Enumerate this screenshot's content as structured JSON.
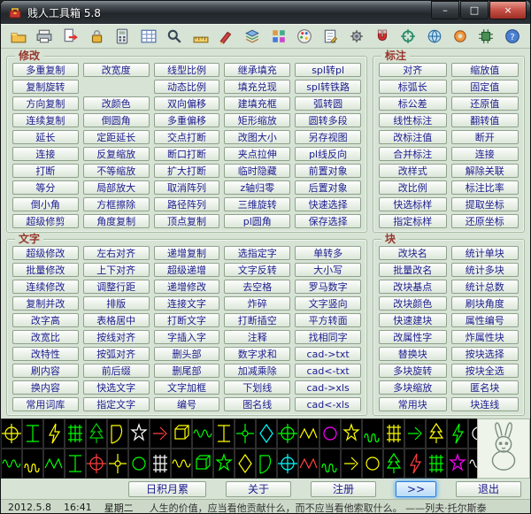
{
  "window": {
    "title": "贱人工具箱 5.8"
  },
  "titlebar_controls": {
    "minimize": "–",
    "maximize": "□",
    "close": "×"
  },
  "colors": {
    "dialog_bg": "#d6e3d5",
    "button_text": "#1b1b8e",
    "group_title": "#97372c",
    "focus_highlight": "#5fb2f5",
    "palette_bg": "#000000"
  },
  "toolbar": {
    "icons": [
      {
        "name": "open-folder-icon",
        "type": "folder"
      },
      {
        "name": "print-icon",
        "type": "print"
      },
      {
        "name": "export-icon",
        "type": "export"
      },
      {
        "name": "lock-icon",
        "type": "lock"
      },
      {
        "name": "calculator-icon",
        "type": "calculator"
      },
      {
        "name": "table-icon",
        "type": "table"
      },
      {
        "name": "search-icon",
        "type": "search"
      },
      {
        "name": "ruler-icon",
        "type": "ruler"
      },
      {
        "name": "brush-icon",
        "type": "brush"
      },
      {
        "name": "layers-icon",
        "type": "layers"
      },
      {
        "name": "blocks-icon",
        "type": "blocks"
      },
      {
        "name": "palette-icon",
        "type": "palette"
      },
      {
        "name": "notepad-icon",
        "type": "notepad"
      },
      {
        "name": "gear-icon",
        "type": "gear"
      },
      {
        "name": "magnet-icon",
        "type": "magnet"
      },
      {
        "name": "crosshair-icon",
        "type": "crosshair"
      },
      {
        "name": "globe-icon",
        "type": "globe"
      },
      {
        "name": "donut-icon",
        "type": "donut"
      },
      {
        "name": "chip-icon",
        "type": "chip"
      },
      {
        "name": "help-icon",
        "type": "help"
      }
    ]
  },
  "sections": {
    "modify": {
      "title": "修改",
      "columns": 5,
      "buttons": [
        "多重复制",
        "改宽度",
        "线型比例",
        "继承填充",
        "spl转pl",
        "复制旋转",
        null,
        "动态比例",
        "填充兑现",
        "spl转铁路",
        "方向复制",
        "改颜色",
        "双向偏移",
        "建填充框",
        "弧转圆",
        "连续复制",
        "倒圆角",
        "多重偏移",
        "矩形缩放",
        "圆转多段",
        "延长",
        "定距延长",
        "交点打断",
        "改图大小",
        "另存视图",
        "连接",
        "反复缩放",
        "断口打断",
        "夹点拉伸",
        "pl线反向",
        "打断",
        "不等缩放",
        "扩大打断",
        "临时隐藏",
        "前置对象",
        "等分",
        "局部放大",
        "取消阵列",
        "z轴归零",
        "后置对象",
        "倒小角",
        "方框擦除",
        "路径阵列",
        "三维旋转",
        "快速选择",
        "超级修剪",
        "角度复制",
        "顶点复制",
        "pl圆角",
        "保存选择"
      ]
    },
    "dimension": {
      "title": "标注",
      "columns": 2,
      "buttons": [
        "对齐",
        "缩放值",
        "标弧长",
        "固定值",
        "标公差",
        "还原值",
        "线性标注",
        "翻转值",
        "改标注值",
        "断开",
        "合并标注",
        "连接",
        "改样式",
        "解除关联",
        "改比例",
        "标注比率",
        "快选标样",
        "提取坐标",
        "指定标样",
        "还原坐标"
      ]
    },
    "text": {
      "title": "文字",
      "columns": 5,
      "buttons": [
        "超级修改",
        "左右对齐",
        "递增复制",
        "选指定字",
        "单转多",
        "批量修改",
        "上下对齐",
        "超级递增",
        "文字反转",
        "大小写",
        "连续修改",
        "调整行距",
        "递增修改",
        "去空格",
        "罗马数字",
        "复制并改",
        "排版",
        "连接文字",
        "炸碎",
        "文字竖向",
        "改字高",
        "表格居中",
        "打断文字",
        "打断插空",
        "平方转面",
        "改宽比",
        "按线对齐",
        "字插入字",
        "注释",
        "找相同字",
        "改特性",
        "按弧对齐",
        "删头部",
        "数字求和",
        "cad->txt",
        "刷内容",
        "前后缀",
        "删尾部",
        "加减乘除",
        "cad<-txt",
        "换内容",
        "快选文字",
        "文字加框",
        "下划线",
        "cad->xls",
        "常用词库",
        "指定文字",
        "编号",
        "图名线",
        "cad<-xls"
      ]
    },
    "block": {
      "title": "块",
      "columns": 2,
      "buttons": [
        "改块名",
        "统计单块",
        "批量改名",
        "统计多块",
        "改块基点",
        "统计总数",
        "改块颜色",
        "刷块角度",
        "快速建块",
        "属性编号",
        "改属性字",
        "炸属性块",
        "替换块",
        "按块选择",
        "多块旋转",
        "按块全选",
        "多块缩放",
        "匿名块",
        "常用块",
        "块连线"
      ]
    }
  },
  "palette": {
    "cells": [
      {
        "shape": "target",
        "color": "#ffff00"
      },
      {
        "shape": "beam",
        "color": "#00ff00"
      },
      {
        "shape": "bolt",
        "color": "#ffff00"
      },
      {
        "shape": "grid",
        "color": "#00ff00"
      },
      {
        "shape": "tree",
        "color": "#00cc00"
      },
      {
        "shape": "door",
        "color": "#ffff00"
      },
      {
        "shape": "star",
        "color": "#ffffff"
      },
      {
        "shape": "arrow",
        "color": "#ff4040"
      },
      {
        "shape": "box",
        "color": "#ffff00"
      },
      {
        "shape": "wave",
        "color": "#00ff00"
      },
      {
        "shape": "beam",
        "color": "#ffff00"
      },
      {
        "shape": "fan",
        "color": "#00ff00"
      },
      {
        "shape": "diamond",
        "color": "#00ffff"
      },
      {
        "shape": "target",
        "color": "#00ff00"
      },
      {
        "shape": "zigzag",
        "color": "#ffff00"
      },
      {
        "shape": "circle",
        "color": "#ff00ff"
      },
      {
        "shape": "star",
        "color": "#ffff00"
      },
      {
        "shape": "spring",
        "color": "#00ff00"
      },
      {
        "shape": "grid",
        "color": "#ffff00"
      },
      {
        "shape": "arrow",
        "color": "#00ff00"
      },
      {
        "shape": "tree",
        "color": "#ffff00"
      },
      {
        "shape": "bolt",
        "color": "#00ff00"
      },
      {
        "shape": "circle",
        "color": "#ffffff"
      },
      {
        "shape": "wave",
        "color": "#00ff00"
      },
      {
        "shape": "spring",
        "color": "#ffff00"
      },
      {
        "shape": "zigzag",
        "color": "#00ff00"
      },
      {
        "shape": "beam",
        "color": "#00ff00"
      },
      {
        "shape": "target",
        "color": "#ff4040"
      },
      {
        "shape": "fan",
        "color": "#ffff00"
      },
      {
        "shape": "circle",
        "color": "#00ff00"
      },
      {
        "shape": "grid",
        "color": "#ffffff"
      },
      {
        "shape": "wave",
        "color": "#ffff00"
      },
      {
        "shape": "box",
        "color": "#00ff00"
      },
      {
        "shape": "star",
        "color": "#00ff00"
      },
      {
        "shape": "diamond",
        "color": "#ffff00"
      },
      {
        "shape": "door",
        "color": "#00ff00"
      },
      {
        "shape": "target",
        "color": "#00ffff"
      },
      {
        "shape": "zigzag",
        "color": "#ff4040"
      },
      {
        "shape": "spring",
        "color": "#00ff00"
      },
      {
        "shape": "arrow",
        "color": "#ffff00"
      },
      {
        "shape": "circle",
        "color": "#ffff00"
      },
      {
        "shape": "tree",
        "color": "#00ff00"
      },
      {
        "shape": "bolt",
        "color": "#ff4040"
      },
      {
        "shape": "grid",
        "color": "#00ff00"
      },
      {
        "shape": "star",
        "color": "#ff00ff"
      },
      {
        "shape": "wave",
        "color": "#ffffff"
      }
    ]
  },
  "footer": {
    "buttons": [
      {
        "name": "daily",
        "label": "日积月累",
        "highlight": false
      },
      {
        "name": "about",
        "label": "关于",
        "highlight": false
      },
      {
        "name": "register",
        "label": "注册",
        "highlight": false
      },
      {
        "name": "expand",
        "label": ">>",
        "highlight": true
      },
      {
        "name": "exit",
        "label": "退出",
        "highlight": false
      }
    ]
  },
  "statusbar": {
    "date": "2012.5.8",
    "time": "16:41",
    "weekday": "星期二",
    "quote": "人生的价值，应当看他贡献什么，而不应当看他索取什么。 ——列夫·托尔斯泰"
  }
}
